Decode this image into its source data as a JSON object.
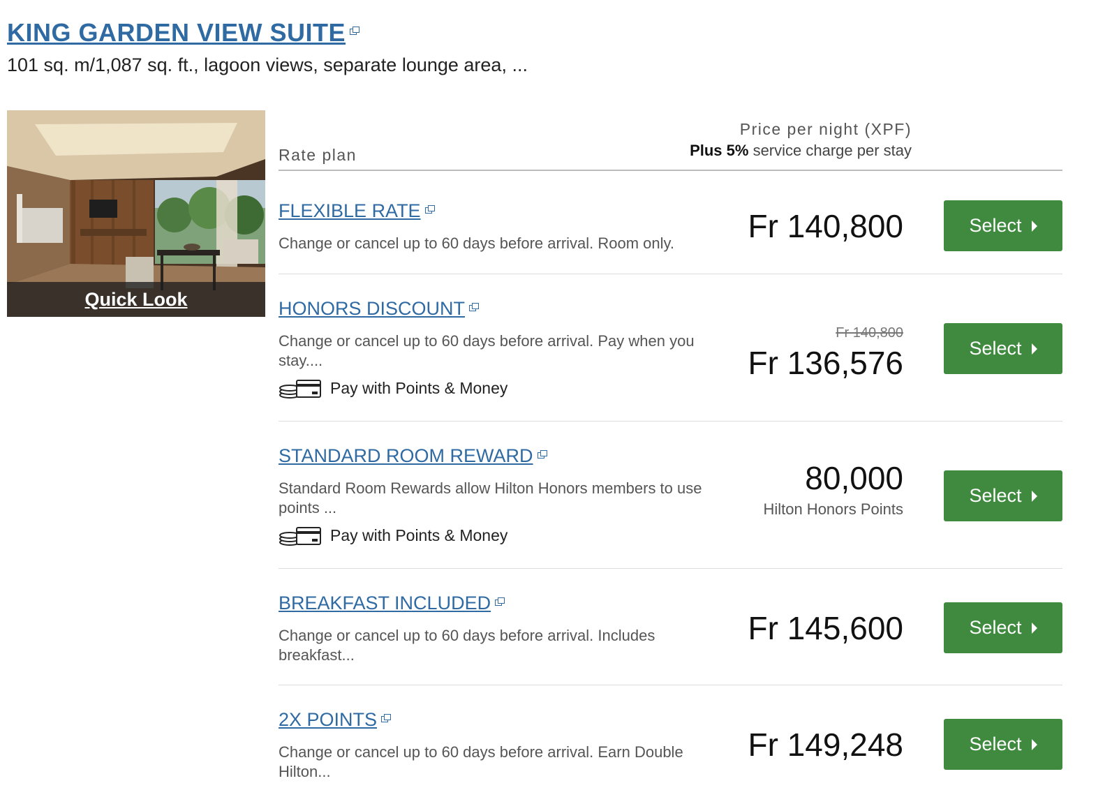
{
  "room": {
    "title": "KING GARDEN VIEW SUITE",
    "description": "101 sq. m/1,087 sq. ft., lagoon views, separate lounge area, ...",
    "quick_look": "Quick Look"
  },
  "header": {
    "rate_plan": "Rate plan",
    "price_per_night": "Price per night (XPF)",
    "service_bold": "Plus 5%",
    "service_rest": " service charge per stay"
  },
  "select_label": "Select",
  "rates": [
    {
      "name": "FLEXIBLE RATE",
      "description": "Change or cancel up to 60 days before arrival. Room only.",
      "price": "Fr 140,800"
    },
    {
      "name": "HONORS DISCOUNT",
      "description": "Change or cancel up to 60 days before arrival. Pay when you stay....",
      "original_price": "Fr 140,800",
      "price": "Fr 136,576",
      "points_money": "Pay with Points & Money"
    },
    {
      "name": "STANDARD ROOM REWARD",
      "description": "Standard Room Rewards allow Hilton Honors members to use points ...",
      "price": "80,000",
      "points_label": "Hilton Honors Points",
      "points_money": "Pay with Points & Money"
    },
    {
      "name": "BREAKFAST INCLUDED",
      "description": "Change or cancel up to 60 days before arrival. Includes breakfast...",
      "price": "Fr 145,600"
    },
    {
      "name": "2X POINTS",
      "description": "Change or cancel up to 60 days before arrival. Earn Double Hilton...",
      "price": "Fr 149,248"
    }
  ],
  "colors": {
    "link": "#2f6aa3",
    "button": "#3f8a3f"
  }
}
